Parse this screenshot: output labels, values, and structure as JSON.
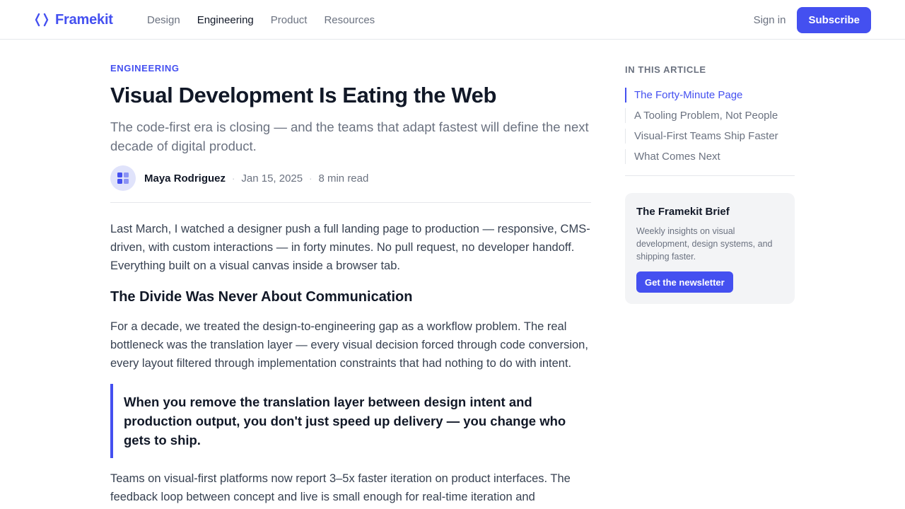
{
  "brand": {
    "name": "Framekit",
    "logo_icon": "code-brackets-icon",
    "accent_color": "#4450f0"
  },
  "nav": {
    "links": [
      {
        "label": "Design",
        "active": false
      },
      {
        "label": "Engineering",
        "active": true
      },
      {
        "label": "Product",
        "active": false
      },
      {
        "label": "Resources",
        "active": false
      }
    ],
    "signin_label": "Sign in",
    "subscribe_label": "Subscribe"
  },
  "article": {
    "category": "ENGINEERING",
    "title": "Visual Development Is Eating the Web",
    "subtitle": "The code-first era is closing — and the teams that adapt fastest will define the next decade of digital product.",
    "author": "Maya Rodriguez",
    "avatar_icon": "grid-avatar-icon",
    "date": "Jan 15, 2025",
    "read_time": "8 min read",
    "intro": "Last March, I watched a designer push a full landing page to production — responsive, CMS-driven, with custom interactions — in forty minutes. No pull request, no developer handoff. Everything built on a visual canvas inside a browser tab.",
    "section_heading": "The Divide Was Never About Communication",
    "section_body": "For a decade, we treated the design-to-engineering gap as a workflow problem. The real bottleneck was the translation layer — every visual decision forced through code conversion, every layout filtered through implementation constraints that had nothing to do with intent.",
    "pull_quote": "When you remove the translation layer between design intent and production output, you don't just speed up delivery — you change who gets to ship.",
    "closing": "Teams on visual-first platforms now report 3–5x faster iteration on product interfaces. The feedback loop between concept and live is small enough for real-time iteration and"
  },
  "sidebar": {
    "toc_heading": "IN THIS ARTICLE",
    "toc": [
      {
        "label": "The Forty-Minute Page",
        "active": true
      },
      {
        "label": "A Tooling Problem, Not People",
        "active": false
      },
      {
        "label": "Visual-First Teams Ship Faster",
        "active": false
      },
      {
        "label": "What Comes Next",
        "active": false
      }
    ],
    "brief": {
      "title": "The Framekit Brief",
      "text": "Weekly insights on visual development, design systems, and shipping faster.",
      "button_label": "Get the newsletter"
    }
  }
}
